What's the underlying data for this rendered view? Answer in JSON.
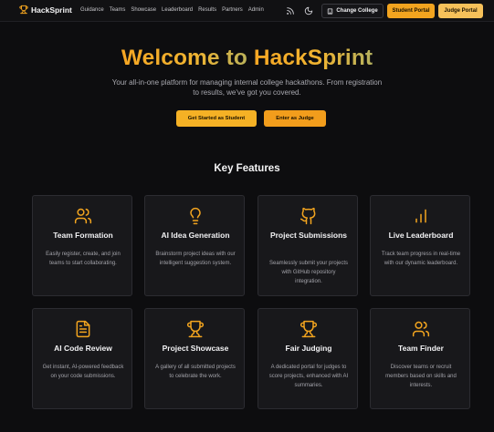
{
  "nav": {
    "brand": "HackSprint",
    "links": [
      "Guidance",
      "Teams",
      "Showcase",
      "Leaderboard",
      "Results",
      "Partners",
      "Admin"
    ],
    "change_college": "Change College",
    "student_portal": "Student Portal",
    "judge_portal": "Judge Portal"
  },
  "hero": {
    "title_prefix": "Welcome to ",
    "title_brand": "HackSprint",
    "subtitle": "Your all-in-one platform for managing internal college hackathons. From registration to results, we've got you covered.",
    "cta_student": "Get Started as Student",
    "cta_judge": "Enter as Judge"
  },
  "features": {
    "title": "Key Features",
    "cards": [
      {
        "icon": "users-icon",
        "title": "Team Formation",
        "desc": "Easily register, create, and join teams to start collaborating."
      },
      {
        "icon": "lightbulb-icon",
        "title": "AI Idea Generation",
        "desc": "Brainstorm project ideas with our intelligent suggestion system."
      },
      {
        "icon": "github-icon",
        "title": "Project Submissions",
        "desc": "Seamlessly submit your projects with GitHub repository integration."
      },
      {
        "icon": "bar-chart-icon",
        "title": "Live Leaderboard",
        "desc": "Track team progress in real-time with our dynamic leaderboard."
      },
      {
        "icon": "file-code-icon",
        "title": "AI Code Review",
        "desc": "Get instant, AI-powered feedback on your code submissions."
      },
      {
        "icon": "trophy-icon",
        "title": "Project Showcase",
        "desc": "A gallery of all submitted projects to celebrate the work."
      },
      {
        "icon": "trophy-icon",
        "title": "Fair Judging",
        "desc": "A dedicated portal for judges to score projects, enhanced with AI summaries."
      },
      {
        "icon": "users-icon",
        "title": "Team Finder",
        "desc": "Discover teams or recruit members based on skills and interests."
      }
    ]
  },
  "colors": {
    "accent": "#f2a41f",
    "accent_light": "#f6c15a",
    "background": "#0d0d0f",
    "card": "#18181b"
  }
}
